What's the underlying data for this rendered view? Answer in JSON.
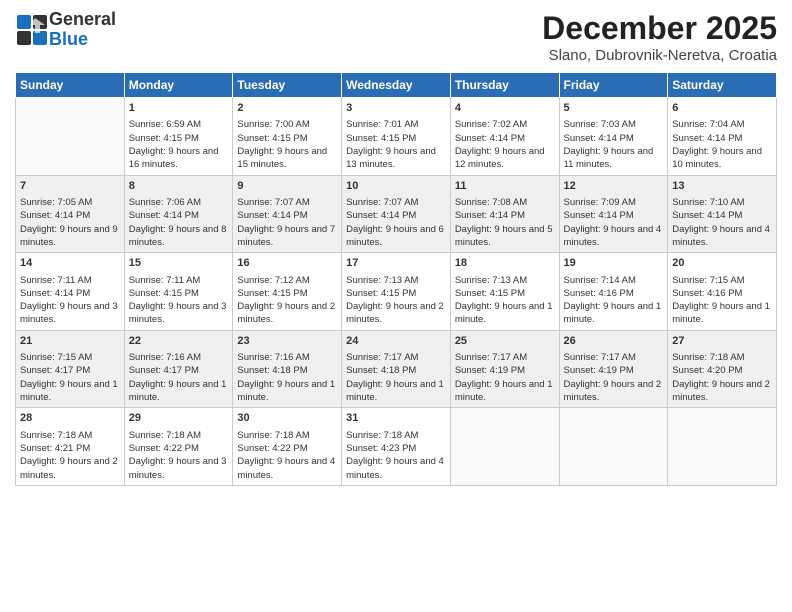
{
  "header": {
    "logo_general": "General",
    "logo_blue": "Blue",
    "month_title": "December 2025",
    "location": "Slano, Dubrovnik-Neretva, Croatia"
  },
  "weekdays": [
    "Sunday",
    "Monday",
    "Tuesday",
    "Wednesday",
    "Thursday",
    "Friday",
    "Saturday"
  ],
  "weeks": [
    [
      {
        "day": "",
        "empty": true
      },
      {
        "day": "1",
        "sunrise": "6:59 AM",
        "sunset": "4:15 PM",
        "daylight": "9 hours and 16 minutes."
      },
      {
        "day": "2",
        "sunrise": "7:00 AM",
        "sunset": "4:15 PM",
        "daylight": "9 hours and 15 minutes."
      },
      {
        "day": "3",
        "sunrise": "7:01 AM",
        "sunset": "4:15 PM",
        "daylight": "9 hours and 13 minutes."
      },
      {
        "day": "4",
        "sunrise": "7:02 AM",
        "sunset": "4:14 PM",
        "daylight": "9 hours and 12 minutes."
      },
      {
        "day": "5",
        "sunrise": "7:03 AM",
        "sunset": "4:14 PM",
        "daylight": "9 hours and 11 minutes."
      },
      {
        "day": "6",
        "sunrise": "7:04 AM",
        "sunset": "4:14 PM",
        "daylight": "9 hours and 10 minutes."
      }
    ],
    [
      {
        "day": "7",
        "sunrise": "7:05 AM",
        "sunset": "4:14 PM",
        "daylight": "9 hours and 9 minutes."
      },
      {
        "day": "8",
        "sunrise": "7:06 AM",
        "sunset": "4:14 PM",
        "daylight": "9 hours and 8 minutes."
      },
      {
        "day": "9",
        "sunrise": "7:07 AM",
        "sunset": "4:14 PM",
        "daylight": "9 hours and 7 minutes."
      },
      {
        "day": "10",
        "sunrise": "7:07 AM",
        "sunset": "4:14 PM",
        "daylight": "9 hours and 6 minutes."
      },
      {
        "day": "11",
        "sunrise": "7:08 AM",
        "sunset": "4:14 PM",
        "daylight": "9 hours and 5 minutes."
      },
      {
        "day": "12",
        "sunrise": "7:09 AM",
        "sunset": "4:14 PM",
        "daylight": "9 hours and 4 minutes."
      },
      {
        "day": "13",
        "sunrise": "7:10 AM",
        "sunset": "4:14 PM",
        "daylight": "9 hours and 4 minutes."
      }
    ],
    [
      {
        "day": "14",
        "sunrise": "7:11 AM",
        "sunset": "4:14 PM",
        "daylight": "9 hours and 3 minutes."
      },
      {
        "day": "15",
        "sunrise": "7:11 AM",
        "sunset": "4:15 PM",
        "daylight": "9 hours and 3 minutes."
      },
      {
        "day": "16",
        "sunrise": "7:12 AM",
        "sunset": "4:15 PM",
        "daylight": "9 hours and 2 minutes."
      },
      {
        "day": "17",
        "sunrise": "7:13 AM",
        "sunset": "4:15 PM",
        "daylight": "9 hours and 2 minutes."
      },
      {
        "day": "18",
        "sunrise": "7:13 AM",
        "sunset": "4:15 PM",
        "daylight": "9 hours and 1 minute."
      },
      {
        "day": "19",
        "sunrise": "7:14 AM",
        "sunset": "4:16 PM",
        "daylight": "9 hours and 1 minute."
      },
      {
        "day": "20",
        "sunrise": "7:15 AM",
        "sunset": "4:16 PM",
        "daylight": "9 hours and 1 minute."
      }
    ],
    [
      {
        "day": "21",
        "sunrise": "7:15 AM",
        "sunset": "4:17 PM",
        "daylight": "9 hours and 1 minute."
      },
      {
        "day": "22",
        "sunrise": "7:16 AM",
        "sunset": "4:17 PM",
        "daylight": "9 hours and 1 minute."
      },
      {
        "day": "23",
        "sunrise": "7:16 AM",
        "sunset": "4:18 PM",
        "daylight": "9 hours and 1 minute."
      },
      {
        "day": "24",
        "sunrise": "7:17 AM",
        "sunset": "4:18 PM",
        "daylight": "9 hours and 1 minute."
      },
      {
        "day": "25",
        "sunrise": "7:17 AM",
        "sunset": "4:19 PM",
        "daylight": "9 hours and 1 minute."
      },
      {
        "day": "26",
        "sunrise": "7:17 AM",
        "sunset": "4:19 PM",
        "daylight": "9 hours and 2 minutes."
      },
      {
        "day": "27",
        "sunrise": "7:18 AM",
        "sunset": "4:20 PM",
        "daylight": "9 hours and 2 minutes."
      }
    ],
    [
      {
        "day": "28",
        "sunrise": "7:18 AM",
        "sunset": "4:21 PM",
        "daylight": "9 hours and 2 minutes."
      },
      {
        "day": "29",
        "sunrise": "7:18 AM",
        "sunset": "4:22 PM",
        "daylight": "9 hours and 3 minutes."
      },
      {
        "day": "30",
        "sunrise": "7:18 AM",
        "sunset": "4:22 PM",
        "daylight": "9 hours and 4 minutes."
      },
      {
        "day": "31",
        "sunrise": "7:18 AM",
        "sunset": "4:23 PM",
        "daylight": "9 hours and 4 minutes."
      },
      {
        "day": "",
        "empty": true
      },
      {
        "day": "",
        "empty": true
      },
      {
        "day": "",
        "empty": true
      }
    ]
  ]
}
